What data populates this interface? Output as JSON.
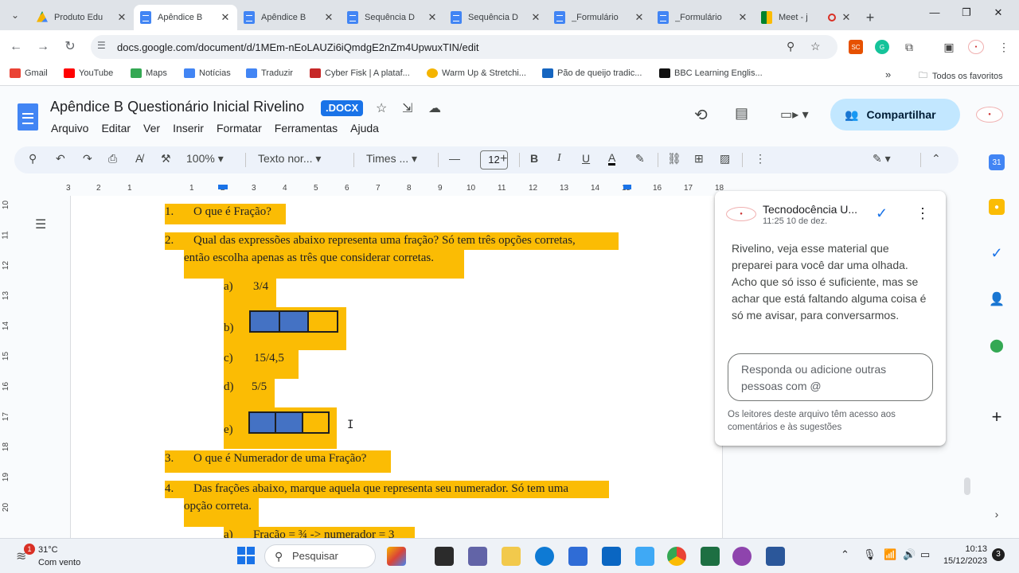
{
  "browser": {
    "tabs": [
      {
        "label": "Produto Edu",
        "icon": "drive",
        "active": false
      },
      {
        "label": "Apêndice B",
        "icon": "docs",
        "active": true
      },
      {
        "label": "Apêndice B",
        "icon": "docs",
        "active": false
      },
      {
        "label": "Sequência D",
        "icon": "docs",
        "active": false
      },
      {
        "label": "Sequência D",
        "icon": "docs",
        "active": false
      },
      {
        "label": "_Formulário",
        "icon": "docs",
        "active": false
      },
      {
        "label": "_Formulário",
        "icon": "docs",
        "active": false
      },
      {
        "label": "Meet - j",
        "icon": "meet",
        "active": false
      }
    ],
    "url": "docs.google.com/document/d/1MEm-nEoLAUZi6iQmdgE2nZm4UpwuxTIN/edit",
    "extension_sc": "SC",
    "bookmarks": [
      {
        "label": "Gmail",
        "color": "#ea4335"
      },
      {
        "label": "YouTube",
        "color": "#ff0000"
      },
      {
        "label": "Maps",
        "color": "#34a853"
      },
      {
        "label": "Notícias",
        "color": "#4285f4"
      },
      {
        "label": "Traduzir",
        "color": "#4285f4"
      },
      {
        "label": "Cyber Fisk | A plataf...",
        "color": "#c62828"
      },
      {
        "label": "Warm Up & Stretchi...",
        "color": "#f4b400"
      },
      {
        "label": "Pão de queijo tradic...",
        "color": "#1565c0"
      },
      {
        "label": "BBC Learning Englis...",
        "color": "#111111"
      }
    ],
    "all_bookmarks": "Todos os favoritos"
  },
  "docs": {
    "title": "Apêndice B Questionário Inicial Rivelino",
    "badge": ".DOCX",
    "menu": [
      "Arquivo",
      "Editar",
      "Ver",
      "Inserir",
      "Formatar",
      "Ferramentas",
      "Ajuda"
    ],
    "share_label": "Compartilhar",
    "zoom": "100%",
    "style": "Texto nor...",
    "font": "Times ...",
    "font_size": "12",
    "ruler": [
      "3",
      "2",
      "1",
      "1",
      "2",
      "3",
      "4",
      "5",
      "6",
      "7",
      "8",
      "9",
      "10",
      "11",
      "12",
      "13",
      "14",
      "15",
      "16",
      "17",
      "18"
    ],
    "vruler": [
      "10",
      "11",
      "12",
      "13",
      "14",
      "15",
      "16",
      "17",
      "18",
      "19",
      "20"
    ]
  },
  "document": {
    "q1": {
      "num": "1.",
      "text": "O que é Fração?"
    },
    "q2": {
      "num": "2.",
      "text": "Qual das expressões abaixo representa uma fração? Só tem três opções corretas,",
      "text2": "então escolha apenas as três que considerar corretas."
    },
    "options": [
      {
        "letter": "a)",
        "text": "3/4"
      },
      {
        "letter": "b)",
        "text": ""
      },
      {
        "letter": "c)",
        "text": "15/4,5"
      },
      {
        "letter": "d)",
        "text": "5/5"
      },
      {
        "letter": "e)",
        "text": ""
      }
    ],
    "q3": {
      "num": "3.",
      "text": "O que é Numerador de uma Fração?"
    },
    "q4": {
      "num": "4.",
      "text": "Das frações abaixo, marque aquela que representa seu numerador. Só tem uma",
      "text2": "opção correta."
    },
    "q4a": {
      "letter": "a)",
      "text": "Fração = ¾ -> numerador = 3"
    },
    "fraction_b": {
      "filled": 2,
      "total": 3
    },
    "fraction_e": {
      "filled": 2,
      "total": 3
    }
  },
  "comment": {
    "author": "Tecnodocência U...",
    "time": "11:25 10 de dez.",
    "body": "Rivelino, veja esse material que preparei para você dar uma olhada. Acho que só isso é suficiente, mas se achar que está faltando alguma coisa é só me avisar, para conversarmos.",
    "reply_placeholder": "Responda ou adicione outras pessoas com @",
    "note": "Os leitores deste arquivo têm acesso aos comentários e às sugestões"
  },
  "taskbar": {
    "weather_temp": "31°C",
    "weather_cond": "Com vento",
    "weather_badge": "1",
    "search": "Pesquisar",
    "time": "10:13",
    "date": "15/12/2023",
    "notifications": "3"
  }
}
